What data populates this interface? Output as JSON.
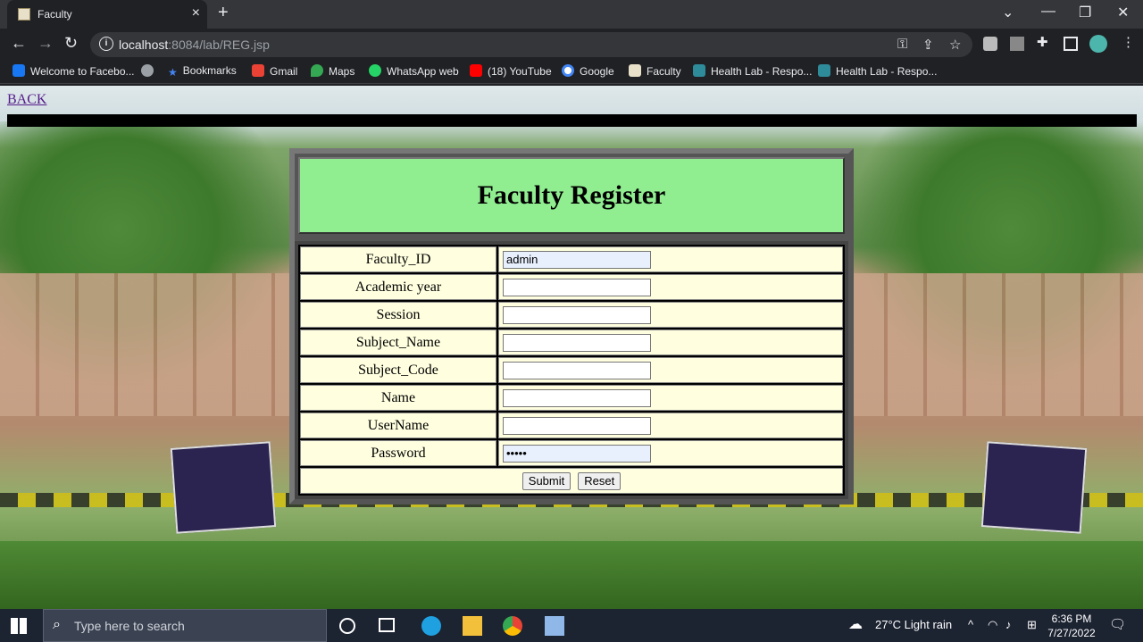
{
  "browser": {
    "tab_title": "Faculty",
    "url_host": "localhost",
    "url_rest": ":8084/lab/REG.jsp"
  },
  "bookmarks": [
    {
      "label": "Welcome to Facebo..."
    },
    {
      "label": ""
    },
    {
      "label": "Bookmarks"
    },
    {
      "label": "Gmail"
    },
    {
      "label": "Maps"
    },
    {
      "label": "WhatsApp web"
    },
    {
      "label": "(18) YouTube"
    },
    {
      "label": "Google"
    },
    {
      "label": "Faculty"
    },
    {
      "label": "Health Lab - Respo..."
    },
    {
      "label": "Health Lab - Respo..."
    }
  ],
  "page": {
    "back_link": "BACK",
    "heading": "Faculty Register",
    "fields": [
      {
        "label": "Faculty_ID",
        "value": "admin"
      },
      {
        "label": "Academic year",
        "value": ""
      },
      {
        "label": "Session",
        "value": ""
      },
      {
        "label": "Subject_Name",
        "value": ""
      },
      {
        "label": "Subject_Code",
        "value": ""
      },
      {
        "label": "Name",
        "value": ""
      },
      {
        "label": "UserName",
        "value": ""
      },
      {
        "label": "Password",
        "value": "•••••"
      }
    ],
    "submit_label": "Submit",
    "reset_label": "Reset"
  },
  "taskbar": {
    "search_placeholder": "Type here to search",
    "weather": "27°C  Light rain",
    "time": "6:36 PM",
    "date": "7/27/2022"
  }
}
